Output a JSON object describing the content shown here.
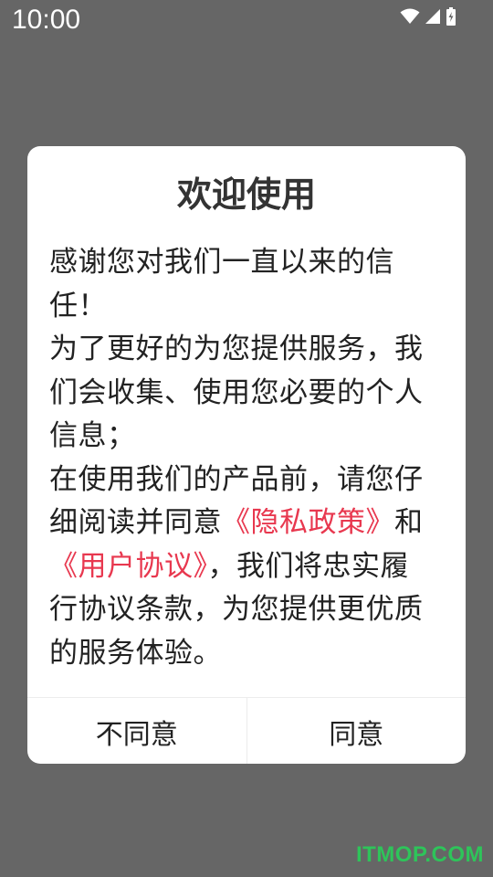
{
  "status_bar": {
    "time": "10:00",
    "icons": [
      "wifi-icon",
      "cellular-signal-icon",
      "battery-charging-icon"
    ]
  },
  "dialog": {
    "title": "欢迎使用",
    "body": {
      "text_1": "感谢您对我们一直以来的信任！",
      "text_2": "为了更好的为您提供服务，我们会收集、使用您必要的个人信息；",
      "text_3": "在使用我们的产品前，请您仔细阅读并同意",
      "link_privacy": "《隐私政策》",
      "text_4": "和",
      "link_user_agreement": "《用户协议》",
      "text_5": "，我们将忠实履行协议条款，为您提供更优质的服务体验。"
    },
    "buttons": {
      "disagree": "不同意",
      "agree": "同意"
    }
  },
  "colors": {
    "overlay": "#666666",
    "dialog_bg": "#ffffff",
    "link": "#e8384f",
    "watermark": "#2ec45a"
  },
  "watermark": "ITMOP.COM"
}
